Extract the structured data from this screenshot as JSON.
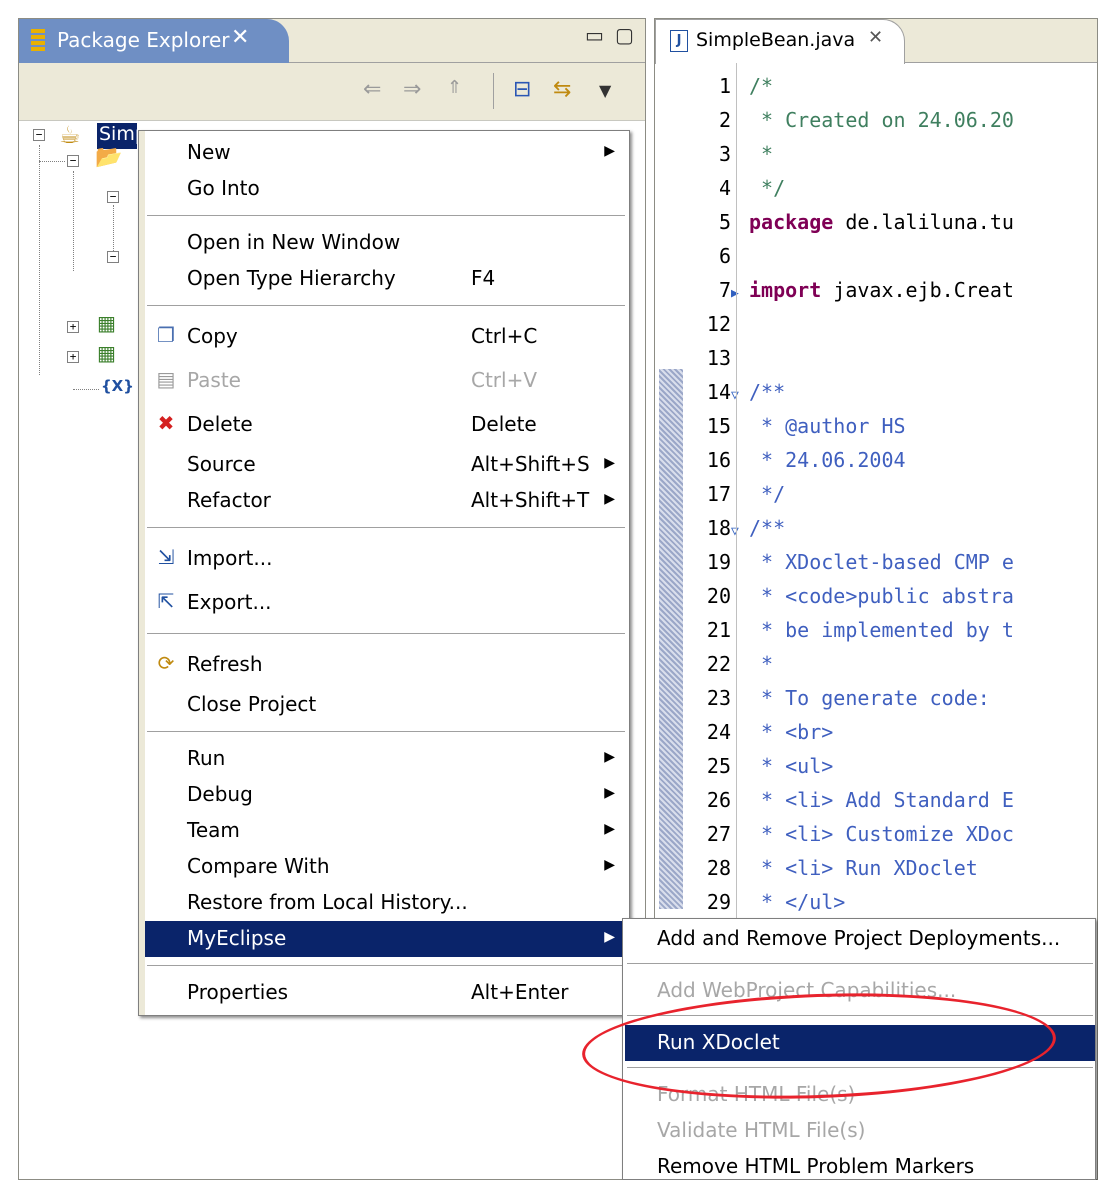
{
  "package_explorer": {
    "title": "Package Explorer",
    "tree": {
      "root_label": "SimpleEJB"
    }
  },
  "editor": {
    "tab_title": "SimpleBean.java",
    "lines": [
      {
        "num": "1",
        "fold": "",
        "parts": [
          {
            "cls": "cm",
            "t": "/*"
          }
        ]
      },
      {
        "num": "2",
        "fold": "",
        "parts": [
          {
            "cls": "cm",
            "t": " * Created on 24.06.20"
          }
        ]
      },
      {
        "num": "3",
        "fold": "",
        "parts": [
          {
            "cls": "cm",
            "t": " *"
          }
        ]
      },
      {
        "num": "4",
        "fold": "",
        "parts": [
          {
            "cls": "cm",
            "t": " */"
          }
        ]
      },
      {
        "num": "5",
        "fold": "",
        "parts": [
          {
            "cls": "kw",
            "t": "package"
          },
          {
            "cls": "tx",
            "t": " de.laliluna.tu"
          }
        ]
      },
      {
        "num": "6",
        "fold": "",
        "parts": []
      },
      {
        "num": "7",
        "fold": "▶",
        "parts": [
          {
            "cls": "kw",
            "t": "import"
          },
          {
            "cls": "tx",
            "t": " javax.ejb.Creat"
          }
        ]
      },
      {
        "num": "12",
        "fold": "",
        "parts": []
      },
      {
        "num": "13",
        "fold": "",
        "parts": []
      },
      {
        "num": "14",
        "fold": "▽",
        "parts": [
          {
            "cls": "jd",
            "t": "/**"
          }
        ]
      },
      {
        "num": "15",
        "fold": "",
        "parts": [
          {
            "cls": "jd",
            "t": " * @author HS"
          }
        ]
      },
      {
        "num": "16",
        "fold": "",
        "parts": [
          {
            "cls": "jd",
            "t": " * 24.06.2004"
          }
        ]
      },
      {
        "num": "17",
        "fold": "",
        "parts": [
          {
            "cls": "jd",
            "t": " */"
          }
        ]
      },
      {
        "num": "18",
        "fold": "▽",
        "parts": [
          {
            "cls": "jd",
            "t": "/**"
          }
        ]
      },
      {
        "num": "19",
        "fold": "",
        "parts": [
          {
            "cls": "jd",
            "t": " * XDoclet-based CMP e"
          }
        ]
      },
      {
        "num": "20",
        "fold": "",
        "parts": [
          {
            "cls": "jd",
            "t": " * <code>public abstra"
          }
        ]
      },
      {
        "num": "21",
        "fold": "",
        "parts": [
          {
            "cls": "jd",
            "t": " * be implemented by t"
          }
        ]
      },
      {
        "num": "22",
        "fold": "",
        "parts": [
          {
            "cls": "jd",
            "t": " *"
          }
        ]
      },
      {
        "num": "23",
        "fold": "",
        "parts": [
          {
            "cls": "jd",
            "t": " * To generate code:"
          }
        ]
      },
      {
        "num": "24",
        "fold": "",
        "parts": [
          {
            "cls": "jd",
            "t": " * <br>"
          }
        ]
      },
      {
        "num": "25",
        "fold": "",
        "parts": [
          {
            "cls": "jd",
            "t": " * <ul>"
          }
        ]
      },
      {
        "num": "26",
        "fold": "",
        "parts": [
          {
            "cls": "jd",
            "t": " * <li> Add Standard E"
          }
        ]
      },
      {
        "num": "27",
        "fold": "",
        "parts": [
          {
            "cls": "jd",
            "t": " * <li> Customize XDoc"
          }
        ]
      },
      {
        "num": "28",
        "fold": "",
        "parts": [
          {
            "cls": "jd",
            "t": " * <li> Run XDoclet"
          }
        ]
      },
      {
        "num": "29",
        "fold": "",
        "parts": [
          {
            "cls": "jd",
            "t": " * </ul>"
          }
        ]
      }
    ]
  },
  "context_menu": {
    "items": [
      {
        "label": "New",
        "accel": "",
        "arrow": true,
        "icon": "",
        "disabled": false,
        "selected": false
      },
      {
        "label": "Go Into",
        "accel": "",
        "arrow": false,
        "icon": "",
        "disabled": false,
        "selected": false
      },
      {
        "sep": true
      },
      {
        "label": "Open in New Window",
        "accel": "",
        "arrow": false,
        "icon": "",
        "disabled": false,
        "selected": false
      },
      {
        "label": "Open Type Hierarchy",
        "accel": "F4",
        "arrow": false,
        "icon": "",
        "disabled": false,
        "selected": false
      },
      {
        "sep": true
      },
      {
        "label": "Copy",
        "accel": "Ctrl+C",
        "arrow": false,
        "icon": "copy-icon",
        "disabled": false,
        "selected": false
      },
      {
        "label": "Paste",
        "accel": "Ctrl+V",
        "arrow": false,
        "icon": "paste-icon",
        "disabled": true,
        "selected": false
      },
      {
        "label": "Delete",
        "accel": "Delete",
        "arrow": false,
        "icon": "delete-icon",
        "disabled": false,
        "selected": false
      },
      {
        "label": "Source",
        "accel": "Alt+Shift+S",
        "arrow": true,
        "icon": "",
        "disabled": false,
        "selected": false
      },
      {
        "label": "Refactor",
        "accel": "Alt+Shift+T",
        "arrow": true,
        "icon": "",
        "disabled": false,
        "selected": false
      },
      {
        "sep": true
      },
      {
        "label": "Import...",
        "accel": "",
        "arrow": false,
        "icon": "import-icon",
        "disabled": false,
        "selected": false
      },
      {
        "label": "Export...",
        "accel": "",
        "arrow": false,
        "icon": "export-icon",
        "disabled": false,
        "selected": false
      },
      {
        "sep": true
      },
      {
        "label": "Refresh",
        "accel": "",
        "arrow": false,
        "icon": "refresh-icon",
        "disabled": false,
        "selected": false
      },
      {
        "label": "Close Project",
        "accel": "",
        "arrow": false,
        "icon": "",
        "disabled": false,
        "selected": false
      },
      {
        "sep": true
      },
      {
        "label": "Run",
        "accel": "",
        "arrow": true,
        "icon": "",
        "disabled": false,
        "selected": false
      },
      {
        "label": "Debug",
        "accel": "",
        "arrow": true,
        "icon": "",
        "disabled": false,
        "selected": false
      },
      {
        "label": "Team",
        "accel": "",
        "arrow": true,
        "icon": "",
        "disabled": false,
        "selected": false
      },
      {
        "label": "Compare With",
        "accel": "",
        "arrow": true,
        "icon": "",
        "disabled": false,
        "selected": false
      },
      {
        "label": "Restore from Local History...",
        "accel": "",
        "arrow": false,
        "icon": "",
        "disabled": false,
        "selected": false
      },
      {
        "label": "MyEclipse",
        "accel": "",
        "arrow": true,
        "icon": "",
        "disabled": false,
        "selected": true
      },
      {
        "sep": true
      },
      {
        "label": "Properties",
        "accel": "Alt+Enter",
        "arrow": false,
        "icon": "",
        "disabled": false,
        "selected": false
      }
    ]
  },
  "submenu": {
    "items": [
      {
        "label": "Add and Remove Project Deployments...",
        "disabled": false,
        "selected": false
      },
      {
        "sep": true
      },
      {
        "label": "Add WebProject Capabilities...",
        "disabled": true,
        "selected": false
      },
      {
        "sep": true
      },
      {
        "label": "Run XDoclet",
        "disabled": false,
        "selected": true
      },
      {
        "sep": true
      },
      {
        "label": "Format HTML File(s)",
        "disabled": true,
        "selected": false
      },
      {
        "label": "Validate HTML File(s)",
        "disabled": true,
        "selected": false
      },
      {
        "label": "Remove HTML Problem Markers",
        "disabled": false,
        "selected": false
      }
    ]
  },
  "colors": {
    "selection": "#0a246a",
    "annotation_oval": "#e8232d",
    "view_tab_active": "#6f8fc4",
    "keyword": "#7f0055",
    "comment": "#3f7f5f",
    "javadoc": "#3f5fbf"
  }
}
